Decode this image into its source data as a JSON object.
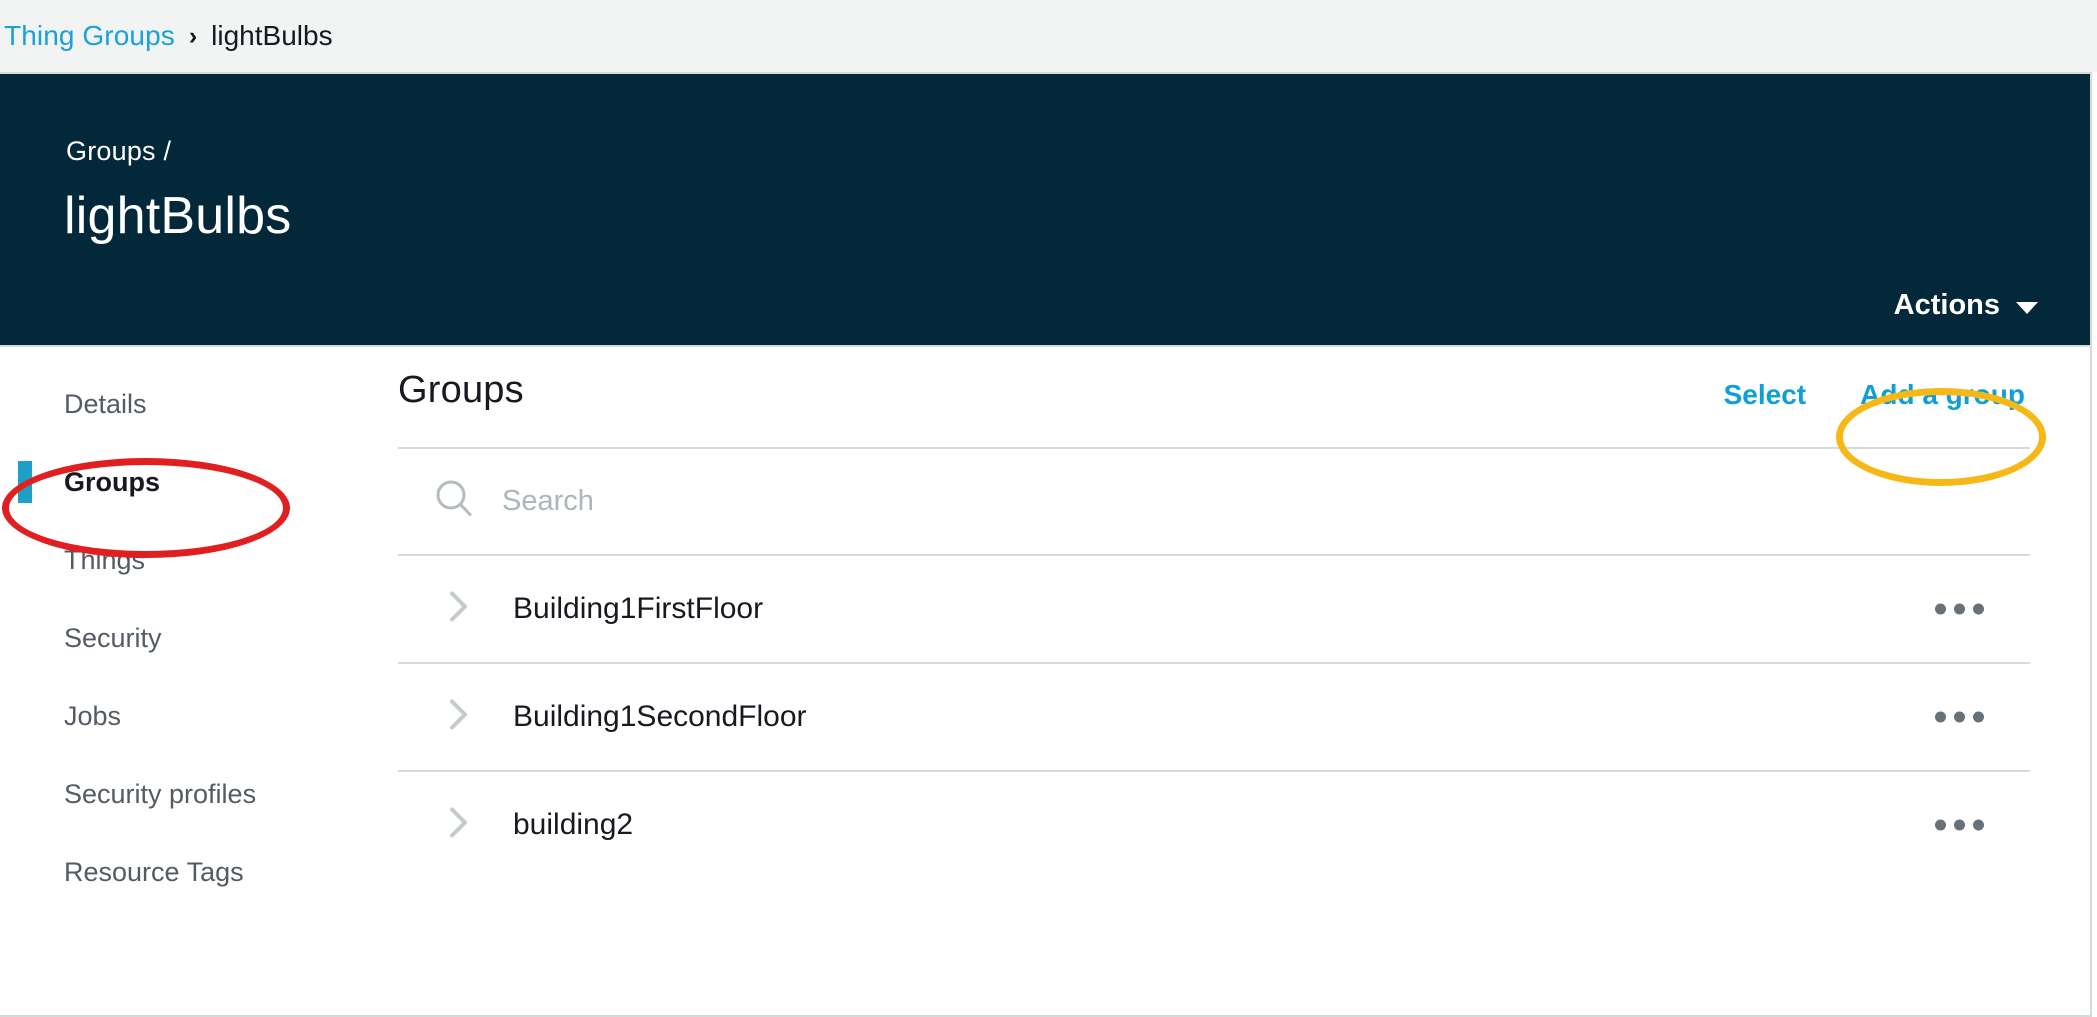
{
  "breadcrumb": {
    "parent_label": "Thing Groups",
    "separator": "›",
    "current_label": "lightBulbs"
  },
  "header": {
    "parent_path": "Groups /",
    "title": "lightBulbs",
    "actions_label": "Actions",
    "caret_icon": "chevron-down-icon",
    "background_color": "#02283a"
  },
  "sidebar": {
    "items": [
      {
        "label": "Details",
        "active": false
      },
      {
        "label": "Groups",
        "active": true
      },
      {
        "label": "Things",
        "active": false
      },
      {
        "label": "Security",
        "active": false
      },
      {
        "label": "Jobs",
        "active": false
      },
      {
        "label": "Security profiles",
        "active": false
      },
      {
        "label": "Resource Tags",
        "active": false
      }
    ],
    "active_indicator_color": "#1e9fc4"
  },
  "content": {
    "title": "Groups",
    "select_label": "Select",
    "add_group_label": "Add a group",
    "link_color": "#0f9fd8",
    "search": {
      "placeholder": "Search",
      "value": "",
      "icon": "search-icon"
    },
    "rows": [
      {
        "name": "Building1FirstFloor",
        "expander_icon": "chevron-right-icon",
        "menu_icon": "ellipsis-icon"
      },
      {
        "name": "Building1SecondFloor",
        "expander_icon": "chevron-right-icon",
        "menu_icon": "ellipsis-icon"
      },
      {
        "name": "building2",
        "expander_icon": "chevron-right-icon",
        "menu_icon": "ellipsis-icon"
      }
    ]
  },
  "annotations": [
    {
      "name": "groups-sidebar-highlight",
      "shape": "ellipse",
      "color": "#e02020"
    },
    {
      "name": "add-a-group-highlight",
      "shape": "ellipse",
      "color": "#f5b817"
    }
  ]
}
